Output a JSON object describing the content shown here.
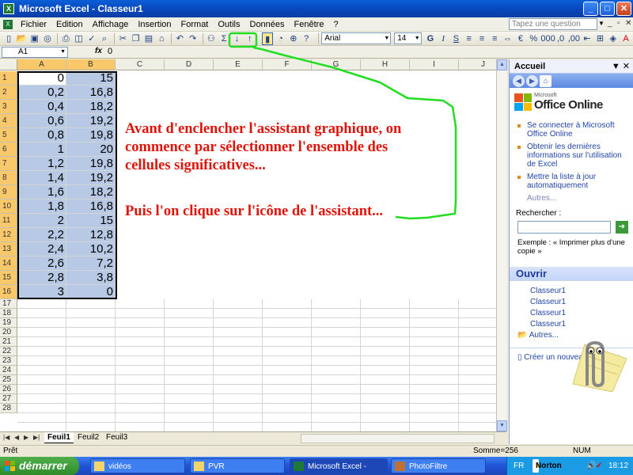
{
  "window": {
    "title": "Microsoft Excel - Classeur1",
    "app_icon": "excel-icon"
  },
  "menu": {
    "items": [
      "Fichier",
      "Edition",
      "Affichage",
      "Insertion",
      "Format",
      "Outils",
      "Données",
      "Fenêtre",
      "?"
    ],
    "ask_placeholder": "Tapez une question"
  },
  "toolbar": {
    "font_name": "Arial",
    "font_size": "14"
  },
  "formula_bar": {
    "name_box": "A1",
    "fx": "fx",
    "value": "0"
  },
  "columns": [
    "A",
    "B",
    "C",
    "D",
    "E",
    "F",
    "G",
    "H",
    "I",
    "J"
  ],
  "rows": [
    {
      "n": "1",
      "a": "0",
      "b": "15"
    },
    {
      "n": "2",
      "a": "0,2",
      "b": "16,8"
    },
    {
      "n": "3",
      "a": "0,4",
      "b": "18,2"
    },
    {
      "n": "4",
      "a": "0,6",
      "b": "19,2"
    },
    {
      "n": "5",
      "a": "0,8",
      "b": "19,8"
    },
    {
      "n": "6",
      "a": "1",
      "b": "20"
    },
    {
      "n": "7",
      "a": "1,2",
      "b": "19,8"
    },
    {
      "n": "8",
      "a": "1,4",
      "b": "19,2"
    },
    {
      "n": "9",
      "a": "1,6",
      "b": "18,2"
    },
    {
      "n": "10",
      "a": "1,8",
      "b": "16,8"
    },
    {
      "n": "11",
      "a": "2",
      "b": "15"
    },
    {
      "n": "12",
      "a": "2,2",
      "b": "12,8"
    },
    {
      "n": "13",
      "a": "2,4",
      "b": "10,2"
    },
    {
      "n": "14",
      "a": "2,6",
      "b": "7,2"
    },
    {
      "n": "15",
      "a": "2,8",
      "b": "3,8"
    },
    {
      "n": "16",
      "a": "3",
      "b": "0"
    }
  ],
  "empty_rows": [
    "17",
    "18",
    "19",
    "20",
    "21",
    "22",
    "23",
    "24",
    "25",
    "26",
    "27",
    "28"
  ],
  "annotation": {
    "line1": "Avant d'enclencher l'assistant graphique, on",
    "line2": "commence par sélectionner l'ensemble des",
    "line3": "cellules significatives...",
    "line4": "Puis l'on clique sur l'icône de l'assistant...",
    "color": "#e0150a",
    "arrow_color": "#22dd22"
  },
  "sheets": [
    "Feuil1",
    "Feuil2",
    "Feuil3"
  ],
  "active_sheet": "Feuil1",
  "status": {
    "left": "Prêt",
    "sum": "Somme=256",
    "mode": "NUM"
  },
  "task_pane": {
    "title": "Accueil",
    "logo_small": "Microsoft",
    "logo_big": "Office Online",
    "links": [
      "Se connecter à Microsoft Office Online",
      "Obtenir les dernières informations sur l'utilisation de Excel",
      "Mettre la liste à jour automatiquement"
    ],
    "more": "Autres...",
    "search_label": "Rechercher :",
    "example": "Exemple : « Imprimer plus d'une copie »",
    "open_title": "Ouvrir",
    "files": [
      "Classeur1",
      "Classeur1",
      "Classeur1",
      "Classeur1"
    ],
    "others": "Autres...",
    "create": "Créer un nouveau classeur..."
  },
  "taskbar": {
    "start": "démarrer",
    "tasks": [
      "vidéos",
      "PVR",
      "Microsoft Excel - Clas...",
      "PhotoFiltre"
    ],
    "lang": "FR",
    "norton": "Norton",
    "clock": "18:12"
  }
}
